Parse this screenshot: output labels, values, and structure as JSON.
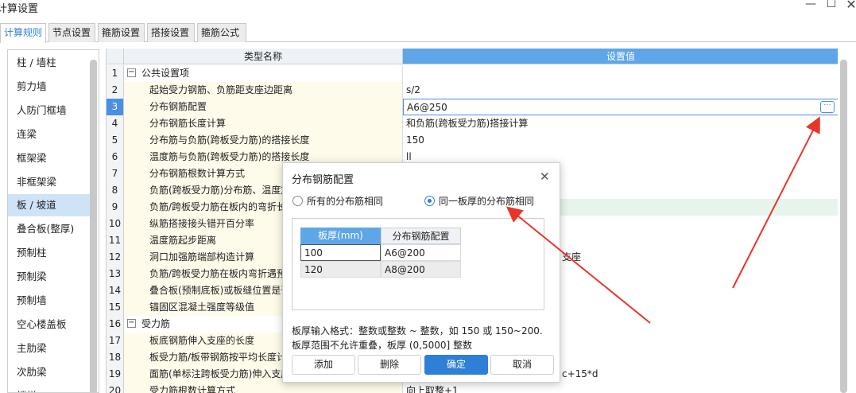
{
  "window": {
    "title": "计算设置",
    "minimize": "—",
    "maximize": "☐",
    "close": "✕"
  },
  "tabs": [
    "计算规则",
    "节点设置",
    "箍筋设置",
    "搭接设置",
    "箍筋公式"
  ],
  "sidebar": [
    "柱 / 墙柱",
    "剪力墙",
    "人防门框墙",
    "连梁",
    "框架梁",
    "非框架梁",
    "板 / 坡道",
    "叠合板(整厚)",
    "预制柱",
    "预制梁",
    "预制墙",
    "空心楼盖板",
    "主肋梁",
    "次肋梁",
    "楼梯"
  ],
  "sidebar_active": 6,
  "grid": {
    "col_name": "类型名称",
    "col_value": "设置值",
    "rows": [
      {
        "num": "1",
        "name": "公共设置项",
        "value": "",
        "group": true
      },
      {
        "num": "2",
        "name": "起始受力钢筋、负筋距支座边距离",
        "value": "s/2"
      },
      {
        "num": "3",
        "name": "分布钢筋配置",
        "value": "A6@250",
        "selected": true
      },
      {
        "num": "4",
        "name": "分布钢筋长度计算",
        "value": "和负筋(跨板受力筋)搭接计算"
      },
      {
        "num": "5",
        "name": "分布筋与负筋(跨板受力筋)的搭接长度",
        "value": "150"
      },
      {
        "num": "6",
        "name": "温度筋与负筋(跨板受力筋)的搭接长度",
        "value": "ll"
      },
      {
        "num": "7",
        "name": "分布钢筋根数计算方式",
        "value": ""
      },
      {
        "num": "8",
        "name": "负筋(跨板受力筋)分布筋、温度筋",
        "value": ""
      },
      {
        "num": "9",
        "name": "负筋/跨板受力筋在板内的弯折长",
        "value": ""
      },
      {
        "num": "10",
        "name": "纵筋搭接接头错开百分率",
        "value": ""
      },
      {
        "num": "11",
        "name": "温度筋起步距离",
        "value": ""
      },
      {
        "num": "12",
        "name": "洞口加强筋端部构造计算",
        "value": "支座"
      },
      {
        "num": "13",
        "name": "负筋/跨板受力筋在板内弯折遇预",
        "value": ""
      },
      {
        "num": "14",
        "name": "叠合板(预制底板)或板缝位置是否",
        "value": ""
      },
      {
        "num": "15",
        "name": "锚固区混凝土强度等级值",
        "value": ""
      },
      {
        "num": "16",
        "name": "受力筋",
        "value": "",
        "group": true
      },
      {
        "num": "17",
        "name": "板底钢筋伸入支座的长度",
        "value": ""
      },
      {
        "num": "18",
        "name": "板受力筋/板带钢筋按平均长度计",
        "value": ""
      },
      {
        "num": "19",
        "name": "面筋(单标注跨板受力筋)伸入支座",
        "value": "c+15*d"
      },
      {
        "num": "20",
        "name": "受力筋根数计算方式",
        "value": "向上取整+1"
      }
    ]
  },
  "dialog": {
    "title": "分布钢筋配置",
    "radio1": "所有的分布筋相同",
    "radio2": "同一板厚的分布筋相同",
    "selected_radio": 2,
    "table_headers": [
      "板厚(mm)",
      "分布钢筋配置"
    ],
    "table_rows": [
      [
        "100",
        "A6@200"
      ],
      [
        "120",
        "A8@200"
      ]
    ],
    "note1": "板厚输入格式：整数或整数 ~ 整数，如 150 或 150~200.",
    "note2": "板厚范围不允许重叠，板厚 (0,5000] 整数",
    "buttons": {
      "add": "添加",
      "delete": "删除",
      "ok": "确定",
      "cancel": "取消"
    }
  },
  "colors": {
    "accent": "#2f7fd6",
    "header_blue": "#5ea6e8",
    "arrow_red": "#e8352a"
  }
}
